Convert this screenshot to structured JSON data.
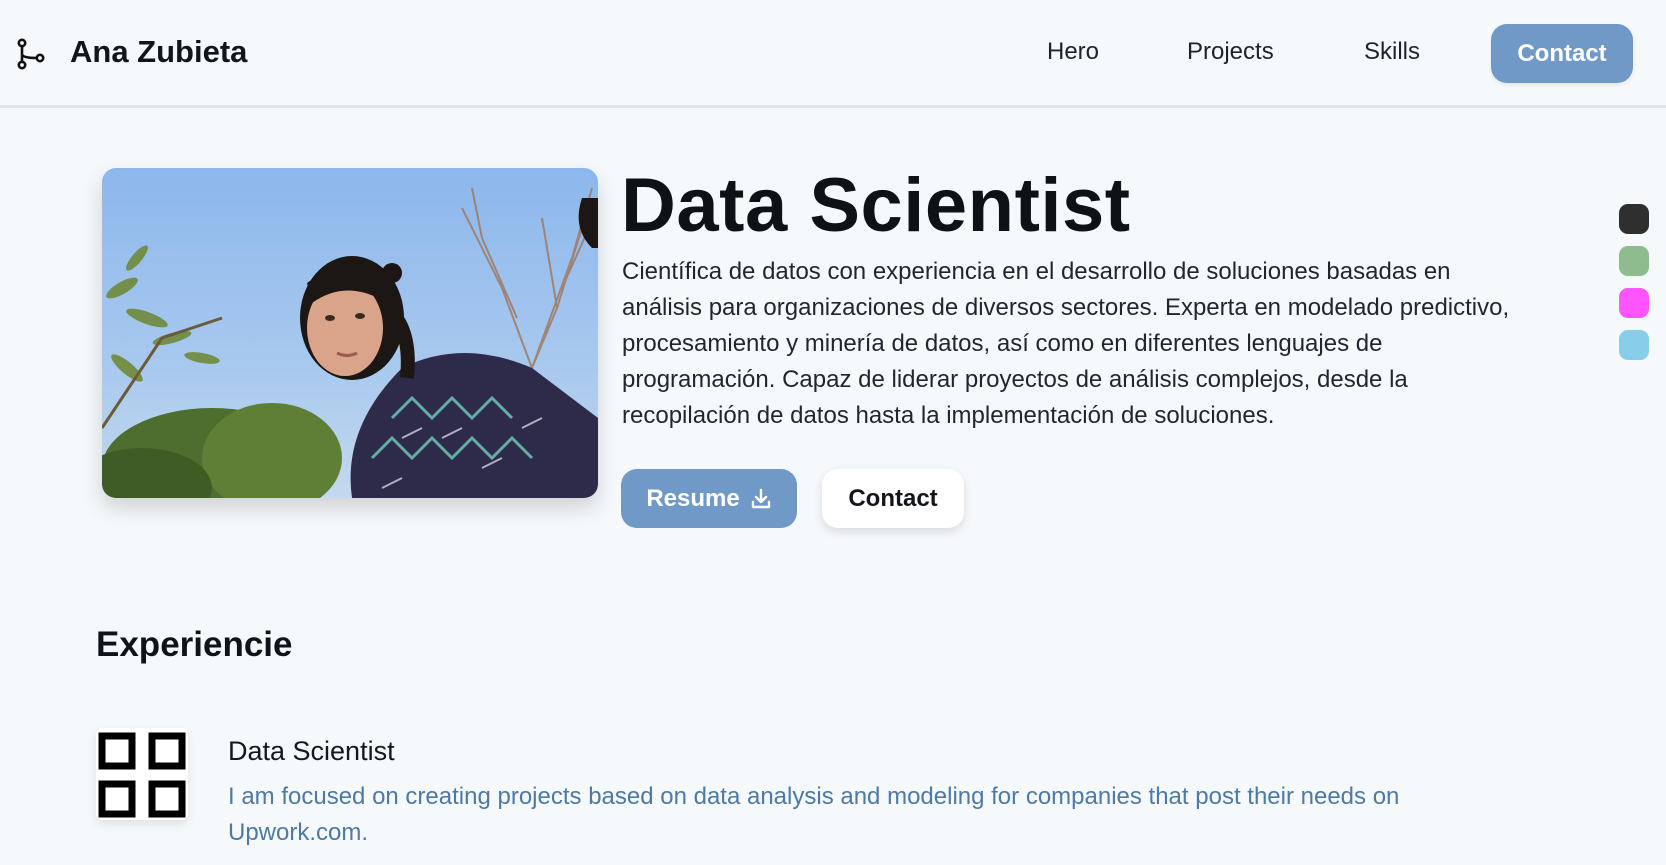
{
  "header": {
    "brand_icon": "git-branch-icon",
    "brand_name": "Ana Zubieta",
    "nav": [
      {
        "label": "Hero"
      },
      {
        "label": "Projects"
      },
      {
        "label": "Skills"
      }
    ],
    "contact_label": "Contact"
  },
  "hero": {
    "title": "Data Scientist",
    "description": "Científica de datos con experiencia en el desarrollo de soluciones basadas en análisis para organizaciones de diversos sectores. Experta en modelado predictivo, procesamiento y minería de datos, así como en diferentes lenguajes de programación. Capaz de liderar proyectos de análisis complejos, desde la recopilación de datos hasta la implementación de soluciones.",
    "resume_label": "Resume",
    "resume_icon": "download-icon",
    "contact_label": "Contact",
    "photo": "profile-photo"
  },
  "theme_swatches": [
    "#2f2f2f",
    "#8fbc8f",
    "#ff55ff",
    "#87ceeb"
  ],
  "experience": {
    "title": "Experiencie",
    "items": [
      {
        "logo_icon": "four-squares-logo-icon",
        "role": "Data Scientist",
        "description": "I am focused on creating projects based on data analysis and modeling for companies that post their needs on Upwork.com."
      }
    ]
  },
  "colors": {
    "accent": "#7099c7",
    "background": "#f6f9fc",
    "description_text": "#4e79a7"
  }
}
